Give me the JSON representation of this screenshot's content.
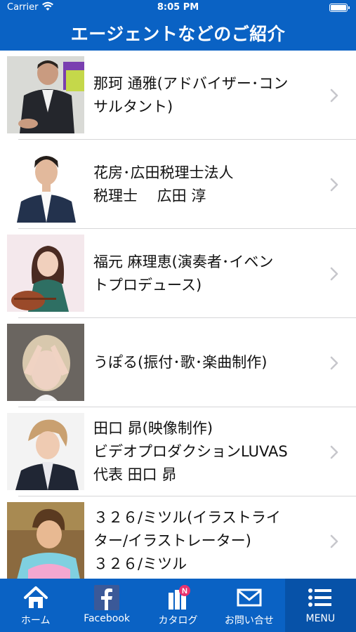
{
  "status": {
    "carrier": "Carrier",
    "time": "8:05 PM"
  },
  "header": {
    "title": "エージェントなどのご紹介"
  },
  "agents": [
    {
      "line1": "那珂 通雅(アドバイザー･コン",
      "line2": "サルタント)",
      "line3": ""
    },
    {
      "line1": "花房･広田税理士法人",
      "line2": "税理士　 広田 淳",
      "line3": ""
    },
    {
      "line1": "福元 麻理恵(演奏者･イベン",
      "line2": "トプロデュース)",
      "line3": ""
    },
    {
      "line1": "うぽる(振付･歌･楽曲制作)",
      "line2": "",
      "line3": ""
    },
    {
      "line1": "田口 昴(映像制作)",
      "line2": "ビデオプロダクションLUVAS",
      "line3": "代表 田口 昴"
    },
    {
      "line1": "３２６/ミツル(イラストライ",
      "line2": "ター/イラストレーター)",
      "line3": "３２６/ミツル"
    }
  ],
  "tabs": [
    {
      "label": "ホーム",
      "icon": "home-icon"
    },
    {
      "label": "Facebook",
      "icon": "facebook-icon"
    },
    {
      "label": "カタログ",
      "icon": "catalog-icon",
      "badge": "N"
    },
    {
      "label": "お問い合せ",
      "icon": "mail-icon"
    },
    {
      "label": "MENU",
      "icon": "menu-icon"
    }
  ],
  "colors": {
    "brand": "#0a62c4",
    "active_tab": "#0752a8",
    "chevron": "#c7c7cc",
    "badge": "#e8336f"
  }
}
